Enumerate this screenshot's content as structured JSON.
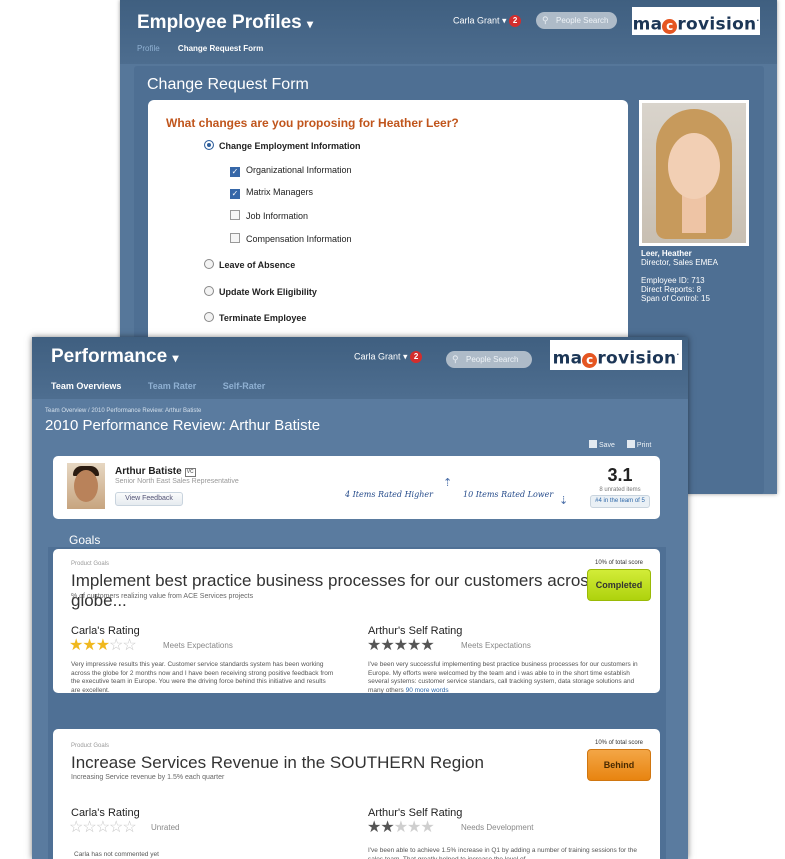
{
  "profiles": {
    "title": "Employee Profiles",
    "user": "Carla Grant",
    "notifications": "2",
    "search_placeholder": "People Search",
    "logo": "ma",
    "logo_o": "c",
    "logo_rest": "rovision",
    "nav": [
      "Profile",
      "Change Request Form"
    ],
    "heading": "Change Request Form",
    "question": "What changes are you proposing for Heather Leer?",
    "options": {
      "change_employment": "Change Employment Information",
      "organizational": "Organizational Information",
      "matrix": "Matrix Managers",
      "job": "Job Information",
      "compensation": "Compensation Information",
      "leave": "Leave of Absence",
      "eligibility": "Update Work Eligibility",
      "terminate": "Terminate Employee"
    },
    "person": {
      "name": "Leer, Heather",
      "title": "Director, Sales EMEA",
      "employee_id": "Employee ID: 713",
      "direct_reports": "Direct Reports: 8",
      "span": "Span of Control: 15"
    }
  },
  "performance": {
    "title": "Performance",
    "user": "Carla Grant",
    "notifications": "2",
    "search_placeholder": "People Search",
    "logo": "ma",
    "logo_o": "c",
    "logo_rest": "rovision",
    "tabs": [
      "Team Overviews",
      "Team Rater",
      "Self-Rater"
    ],
    "breadcrumb": "Team Overview / 2010 Performance Review: Arthur Batiste",
    "heading": "2010 Performance Review: Arthur Batiste",
    "save": "Save",
    "print": "Print",
    "employee": {
      "name": "Arthur Batiste",
      "vcard": "VC",
      "title": "Senior North East Sales  Representative",
      "feedback": "View Feedback",
      "higher_note": "4 Items Rated Higher",
      "lower_note": "10 Items Rated Lower",
      "score": "3.1",
      "unrated": "8 unrated items",
      "rank": "#4 in the team of 5"
    },
    "goals_label": "Goals",
    "goals": [
      {
        "category": "Product Goals",
        "title": "Implement best practice business processes for our customers across the globe...",
        "subtitle": "% of customers realizing value from ACE Services projects",
        "pct": "10% of total score",
        "status": "Completed",
        "manager_rating_label": "Carla's Rating",
        "manager_stars": 3,
        "manager_stars_text": "Meets Expectations",
        "manager_comment": "Very impressive results this year. Customer service standards system has been working across the globe for 2 months now and I have been receiving strong positive feedback from the executive team in Europe. You were the driving force behind this initiative and results are excellent.",
        "self_rating_label": "Arthur's Self Rating",
        "self_stars": 5,
        "self_stars_text": "Meets Expectations",
        "self_comment": "I've been very successful implementing best practice business processes for our customers in Europe. My efforts were welcomed by the team and i was able to in the short time establish several systems: customer service standars, call tracking system, data storage solutions and many others",
        "more_link": "90 more words"
      },
      {
        "category": "Product Goals",
        "title": "Increase Services Revenue in the SOUTHERN Region",
        "subtitle": "Increasing Service revenue by 1.5% each quarter",
        "pct": "10% of total score",
        "status": "Behind",
        "manager_rating_label": "Carla's Rating",
        "manager_stars": 0,
        "manager_stars_text": "Unrated",
        "manager_comment": "Carla has not commented yet",
        "self_rating_label": "Arthur's Self Rating",
        "self_stars": 2,
        "self_stars_text": "Needs Development",
        "self_comment": "I've been able to achieve 1.5% increase in Q1 by adding a number of training sessions for the sales team. That greatly helped to increase the level of"
      }
    ]
  },
  "colors": {
    "header": "#45678a",
    "panel": "#56779a",
    "accent_orange": "#c0551c",
    "completed": "#b5d51a",
    "behind": "#ea8a1a",
    "star_gold": "#f0b81e",
    "star_gray": "#555555"
  }
}
